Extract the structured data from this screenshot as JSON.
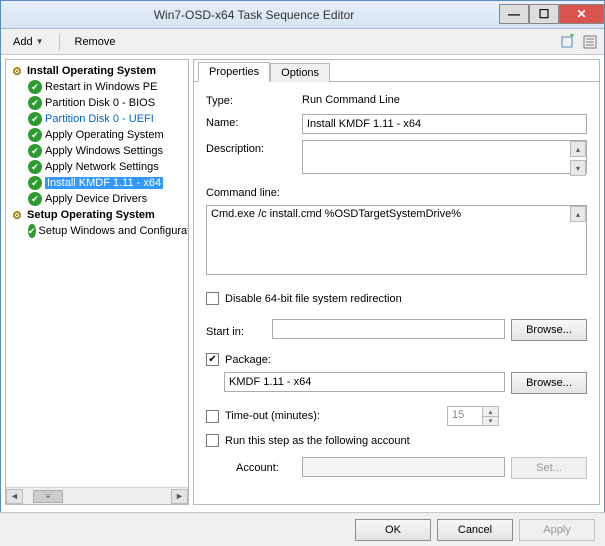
{
  "window": {
    "title": "Win7-OSD-x64 Task Sequence Editor"
  },
  "toolbar": {
    "add": "Add",
    "remove": "Remove"
  },
  "tree": {
    "group1": "Install Operating System",
    "items1": [
      "Restart in Windows PE",
      "Partition Disk 0 - BIOS",
      "Partition Disk 0 - UEFI",
      "Apply Operating System",
      "Apply Windows Settings",
      "Apply Network Settings",
      "Install KMDF 1.11 - x64",
      "Apply Device Drivers"
    ],
    "group2": "Setup Operating System",
    "items2": [
      "Setup Windows and Configuration"
    ]
  },
  "tabs": {
    "properties": "Properties",
    "options": "Options"
  },
  "form": {
    "type_label": "Type:",
    "type_value": "Run Command Line",
    "name_label": "Name:",
    "name_value": "Install KMDF 1.11 - x64",
    "desc_label": "Description:",
    "desc_value": "",
    "cmdline_label": "Command line:",
    "cmdline_value": "Cmd.exe /c install.cmd %OSDTargetSystemDrive%",
    "disable64_label": "Disable 64-bit file system redirection",
    "startin_label": "Start in:",
    "startin_value": "",
    "browse1": "Browse...",
    "package_label": "Package:",
    "package_value": "KMDF 1.11 - x64",
    "browse2": "Browse...",
    "timeout_label": "Time-out (minutes):",
    "timeout_value": "15",
    "runas_label": "Run this step as the following account",
    "account_label": "Account:",
    "account_value": "",
    "set_btn": "Set..."
  },
  "buttons": {
    "ok": "OK",
    "cancel": "Cancel",
    "apply": "Apply"
  }
}
